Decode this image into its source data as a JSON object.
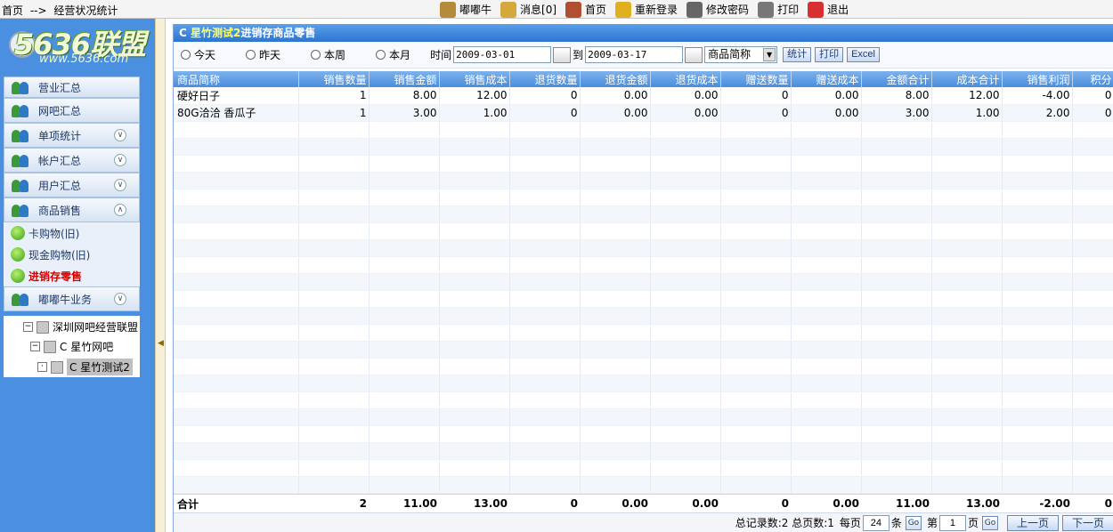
{
  "breadcrumb": {
    "home": "首页",
    "sep": "-->",
    "current": "经营状况统计"
  },
  "topmenu": [
    {
      "label": "嘟嘟牛",
      "icon": "cow-icon",
      "color": "#b58a3a"
    },
    {
      "label": "消息[0]",
      "icon": "message-icon",
      "color": "#d4a83a"
    },
    {
      "label": "首页",
      "icon": "home-icon",
      "color": "#b05030"
    },
    {
      "label": "重新登录",
      "icon": "relogin-icon",
      "color": "#e0b020"
    },
    {
      "label": "修改密码",
      "icon": "password-icon",
      "color": "#666666"
    },
    {
      "label": "打印",
      "icon": "printer-icon",
      "color": "#777777"
    },
    {
      "label": "退出",
      "icon": "exit-icon",
      "color": "#d83030"
    }
  ],
  "logo": {
    "text": "5636联盟",
    "url": "www.5636.com"
  },
  "sidebar": {
    "items": [
      {
        "label": "营业汇总",
        "chevron": ""
      },
      {
        "label": "网吧汇总",
        "chevron": ""
      },
      {
        "label": "单项统计",
        "chevron": "∨"
      },
      {
        "label": "帐户汇总",
        "chevron": "∨"
      },
      {
        "label": "用户汇总",
        "chevron": "∨"
      },
      {
        "label": "商品销售",
        "chevron": "∧"
      }
    ],
    "subitems": [
      {
        "label": "卡购物(旧)"
      },
      {
        "label": "现金购物(旧)"
      },
      {
        "label": "进销存零售"
      }
    ],
    "last": {
      "label": "嘟嘟牛业务",
      "chevron": "∨"
    }
  },
  "tree": {
    "root": "深圳网吧经营联盟",
    "child": "C 星竹网吧",
    "leaf": "C 星竹测试2"
  },
  "panel": {
    "title_prefix": "C ",
    "title_hl": "星竹测试2",
    "title_rest": "进销存商品零售"
  },
  "filters": {
    "today": "今天",
    "yesterday": "昨天",
    "week": "本周",
    "month": "本月",
    "time_label": "时间",
    "date_from": "2009-03-01",
    "to_label": "到",
    "date_to": "2009-03-17",
    "sort_select": "商品简称",
    "stat_btn": "统计",
    "print_btn": "打印",
    "excel_btn": "Excel"
  },
  "table": {
    "headers": [
      "商品简称",
      "销售数量",
      "销售金额",
      "销售成本",
      "退货数量",
      "退货金额",
      "退货成本",
      "赠送数量",
      "赠送成本",
      "金额合计",
      "成本合计",
      "销售利润",
      "积分"
    ],
    "rows": [
      [
        "硬好日子",
        "1",
        "8.00",
        "12.00",
        "0",
        "0.00",
        "0.00",
        "0",
        "0.00",
        "8.00",
        "12.00",
        "-4.00",
        "0"
      ],
      [
        "80G洽洽 香瓜子",
        "1",
        "3.00",
        "1.00",
        "0",
        "0.00",
        "0.00",
        "0",
        "0.00",
        "3.00",
        "1.00",
        "2.00",
        "0"
      ]
    ],
    "total": [
      "合计",
      "2",
      "11.00",
      "13.00",
      "0",
      "0.00",
      "0.00",
      "0",
      "0.00",
      "11.00",
      "13.00",
      "-2.00",
      "0"
    ]
  },
  "pager": {
    "summary": "总记录数:2 总页数:1",
    "per_page_label": "每页",
    "per_page": "24",
    "per_page_unit": "条",
    "go1": "Go",
    "page_label": "第",
    "page": "1",
    "page_unit": "页",
    "go2": "Go",
    "prev": "上一页",
    "next": "下一页"
  }
}
